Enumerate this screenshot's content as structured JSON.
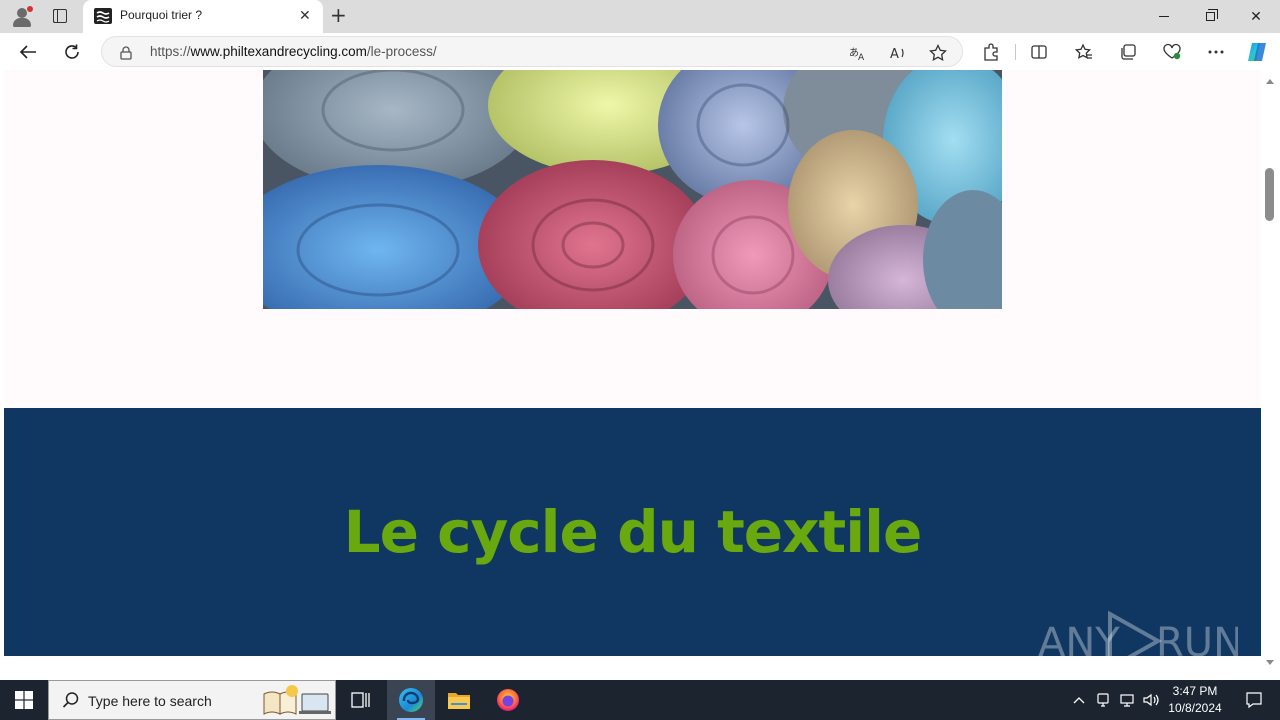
{
  "browser": {
    "tab": {
      "title": "Pourquoi trier ?"
    },
    "address": {
      "scheme": "https://",
      "host": "www.philtexandrecycling.com",
      "path": "/le-process/"
    }
  },
  "page": {
    "heading": "Le cycle du textile",
    "colors": {
      "band": "#0f3761",
      "heading": "#6aa810",
      "background": "#fffbfd"
    }
  },
  "watermark": {
    "text": "ANY RUN"
  },
  "taskbar": {
    "search_placeholder": "Type here to search",
    "time": "3:47 PM",
    "date": "10/8/2024"
  }
}
